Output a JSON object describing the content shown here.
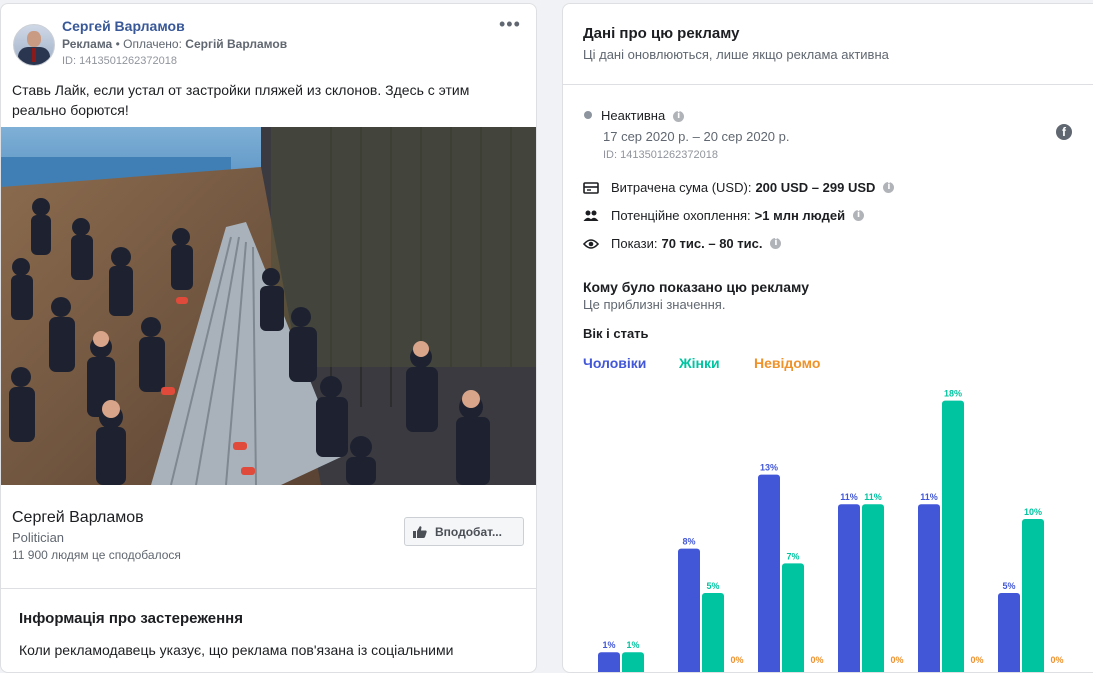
{
  "post": {
    "page_name": "Сергей Варламов",
    "sponsored_label": "Реклама",
    "paid_label": "Оплачено:",
    "paid_by": "Сергій Варламов",
    "ad_id": "ID: 1413501262372018",
    "more_icon": "more-options-icon",
    "text": "Ставь Лайк, если устал от застройки пляжей из склонов. Здесь с этим реально борются!",
    "footer_name": "Сергей Варламов",
    "footer_category": "Politician",
    "footer_likes": "11 900 людям це сподобалося",
    "like_button": "Вподобат..."
  },
  "disclaimer": {
    "title": "Інформація про застереження",
    "text": "Коли рекламодавець указує, що реклама пов'язана із соціальними"
  },
  "details": {
    "title": "Дані про цю рекламу",
    "subtitle": "Ці дані оновлюються, лише якщо реклама активна",
    "status": "Неактивна",
    "dates": "17 сер 2020 р. – 20 сер 2020 р.",
    "id": "ID: 1413501262372018",
    "spend_label": "Витрачена сума (USD):",
    "spend_value": "200 USD – 299 USD",
    "reach_label": "Потенційне охоплення:",
    "reach_value": ">1 млн людей",
    "impressions_label": "Покази:",
    "impressions_value": "70 тис. – 80 тис.",
    "section_title": "Кому було показано цю рекламу",
    "section_sub": "Це приблизні значення.",
    "age_gender_title": "Вік і стать",
    "legend": [
      "Чоловіки",
      "Жінки",
      "Невідомо"
    ]
  },
  "colors": {
    "men": "#4257d8",
    "women": "#00c4a0",
    "unknown": "#f0922a",
    "brand": "#385898"
  },
  "chart_data": {
    "type": "bar",
    "series": [
      {
        "name": "Чоловіки",
        "values": [
          1,
          8,
          13,
          11,
          11,
          5
        ]
      },
      {
        "name": "Жінки",
        "values": [
          1,
          5,
          7,
          11,
          18,
          10
        ]
      },
      {
        "name": "Невідомо",
        "values": [
          0,
          0,
          0,
          0,
          0,
          0
        ]
      }
    ],
    "labels": {
      "Чоловіки": [
        "1%",
        "8%",
        "13%",
        "11%",
        "11%",
        "5%"
      ],
      "Жінки": [
        "1%",
        "5%",
        "7%",
        "11%",
        "18%",
        "10%"
      ],
      "Невідомо": [
        "",
        "0%",
        "0%",
        "0%",
        "0%",
        "0%"
      ]
    }
  }
}
